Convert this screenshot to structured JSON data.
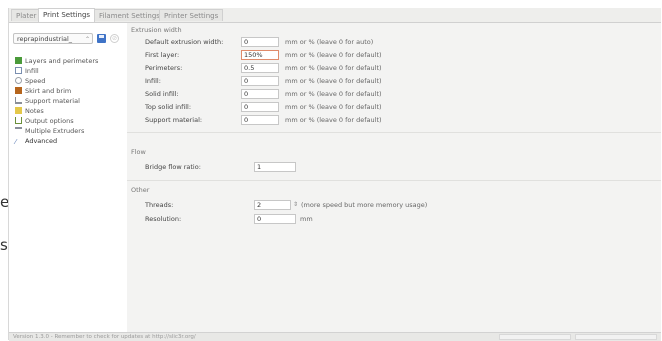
{
  "tabs": [
    "Plater",
    "Print Settings",
    "Filament Settings",
    "Printer Settings"
  ],
  "preset": {
    "value": "reprapindustrial_"
  },
  "categories": [
    {
      "label": "Layers and perimeters",
      "icon": "layers-icon",
      "color": "#4a9a3a"
    },
    {
      "label": "Infill",
      "icon": "infill-icon",
      "color": "#7a8fb0"
    },
    {
      "label": "Speed",
      "icon": "speed-icon",
      "color": "#9aa0a8"
    },
    {
      "label": "Skirt and brim",
      "icon": "skirt-icon",
      "color": "#b5651d"
    },
    {
      "label": "Support material",
      "icon": "support-icon",
      "color": "#8a8f98"
    },
    {
      "label": "Notes",
      "icon": "notes-icon",
      "color": "#e4c84a"
    },
    {
      "label": "Output options",
      "icon": "output-icon",
      "color": "#6b8f3a"
    },
    {
      "label": "Multiple Extruders",
      "icon": "extruders-icon",
      "color": "#8a8f98"
    },
    {
      "label": "Advanced",
      "icon": "wrench-icon",
      "color": "#5a7bb5"
    }
  ],
  "extrusion_width": {
    "title": "Extrusion width",
    "rows": [
      {
        "label": "Default extrusion width:",
        "value": "0",
        "unit": "mm or % (leave 0 for auto)"
      },
      {
        "label": "First layer:",
        "value": "150%",
        "unit": "mm or % (leave 0 for default)"
      },
      {
        "label": "Perimeters:",
        "value": "0.5",
        "unit": "mm or % (leave 0 for default)"
      },
      {
        "label": "Infill:",
        "value": "0",
        "unit": "mm or % (leave 0 for default)"
      },
      {
        "label": "Solid infill:",
        "value": "0",
        "unit": "mm or % (leave 0 for default)"
      },
      {
        "label": "Top solid infill:",
        "value": "0",
        "unit": "mm or % (leave 0 for default)"
      },
      {
        "label": "Support material:",
        "value": "0",
        "unit": "mm or % (leave 0 for default)"
      }
    ]
  },
  "flow": {
    "title": "Flow",
    "bridge_label": "Bridge flow ratio:",
    "bridge_value": "1"
  },
  "other": {
    "title": "Other",
    "threads_label": "Threads:",
    "threads_value": "2",
    "threads_hint": "(more speed but more memory usage)",
    "resolution_label": "Resolution:",
    "resolution_value": "0",
    "resolution_unit": "mm"
  },
  "status": {
    "text": "Version 1.3.0 - Remember to check for updates at http://slic3r.org/"
  },
  "edge_glyphs": [
    "e",
    "s"
  ],
  "colors": {
    "accent": "#3f73c7",
    "focus_border": "#e08a6a"
  }
}
